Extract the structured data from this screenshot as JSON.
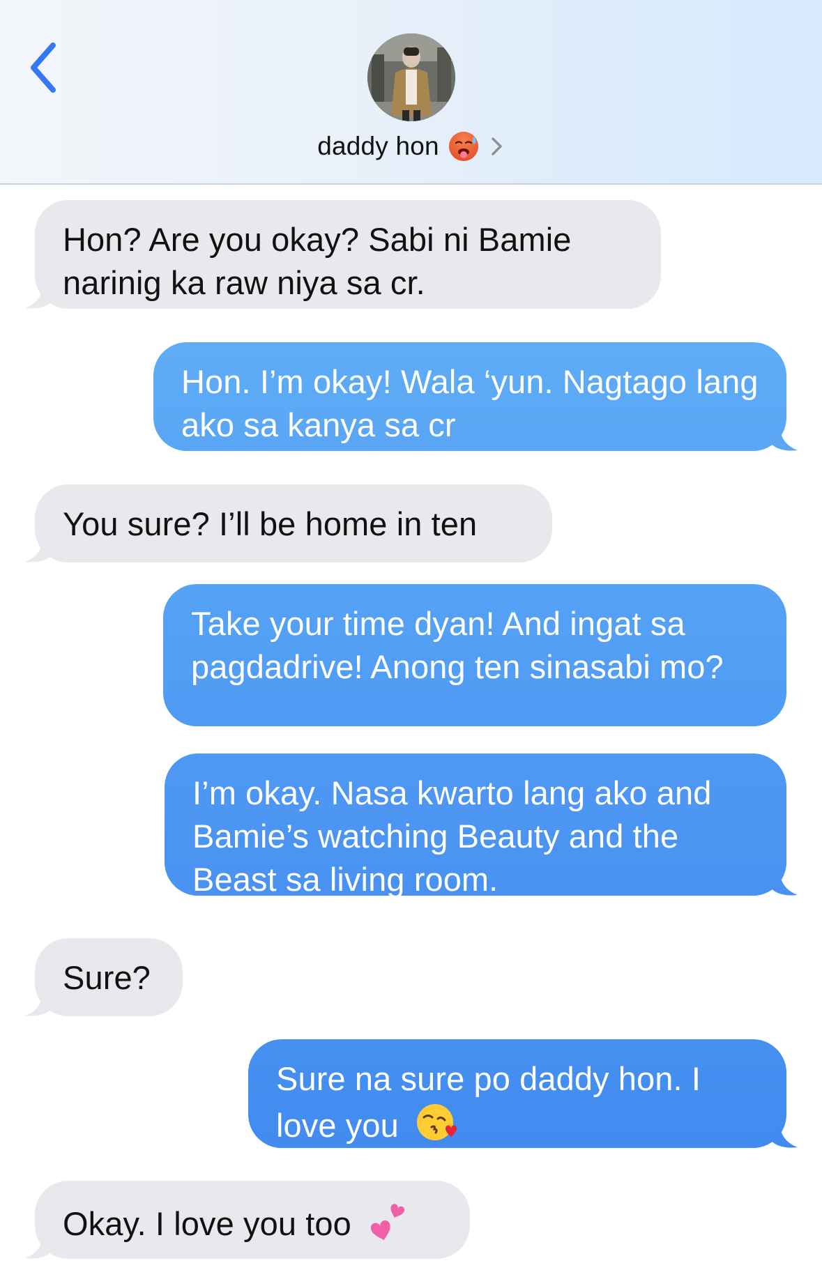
{
  "header": {
    "back_icon": "chevron-left-icon",
    "contact_name": "daddy hon",
    "contact_emoji": "hot-face-emoji",
    "chevron_icon": "chevron-right-icon",
    "accent_color": "#3478f6"
  },
  "messages": [
    {
      "direction": "received",
      "text": "Hon? Are you okay? Sabi ni Bamie narinig ka raw niya sa cr."
    },
    {
      "direction": "sent",
      "text": "Hon. I’m okay! Wala ‘yun. Nagtago lang ako sa kanya sa cr"
    },
    {
      "direction": "received",
      "text": "You sure? I’ll be home in ten"
    },
    {
      "direction": "sent",
      "text": "Take your time dyan! And ingat sa pagdadrive! Anong ten sinasabi mo?"
    },
    {
      "direction": "sent",
      "text": "I’m okay. Nasa kwarto lang ako and Bamie’s watching Beauty and the Beast sa living room."
    },
    {
      "direction": "received",
      "text": "Sure?"
    },
    {
      "direction": "sent",
      "text": "Sure na sure po daddy hon. I love you",
      "emoji": "face-blowing-kiss-emoji"
    },
    {
      "direction": "received",
      "text": "Okay. I love you too",
      "emoji": "two-hearts-emoji"
    }
  ],
  "colors": {
    "received_bubble": "#e8e8ed",
    "sent_bubble_top": "#5ca9f6",
    "sent_bubble_bottom": "#3f87f1"
  }
}
